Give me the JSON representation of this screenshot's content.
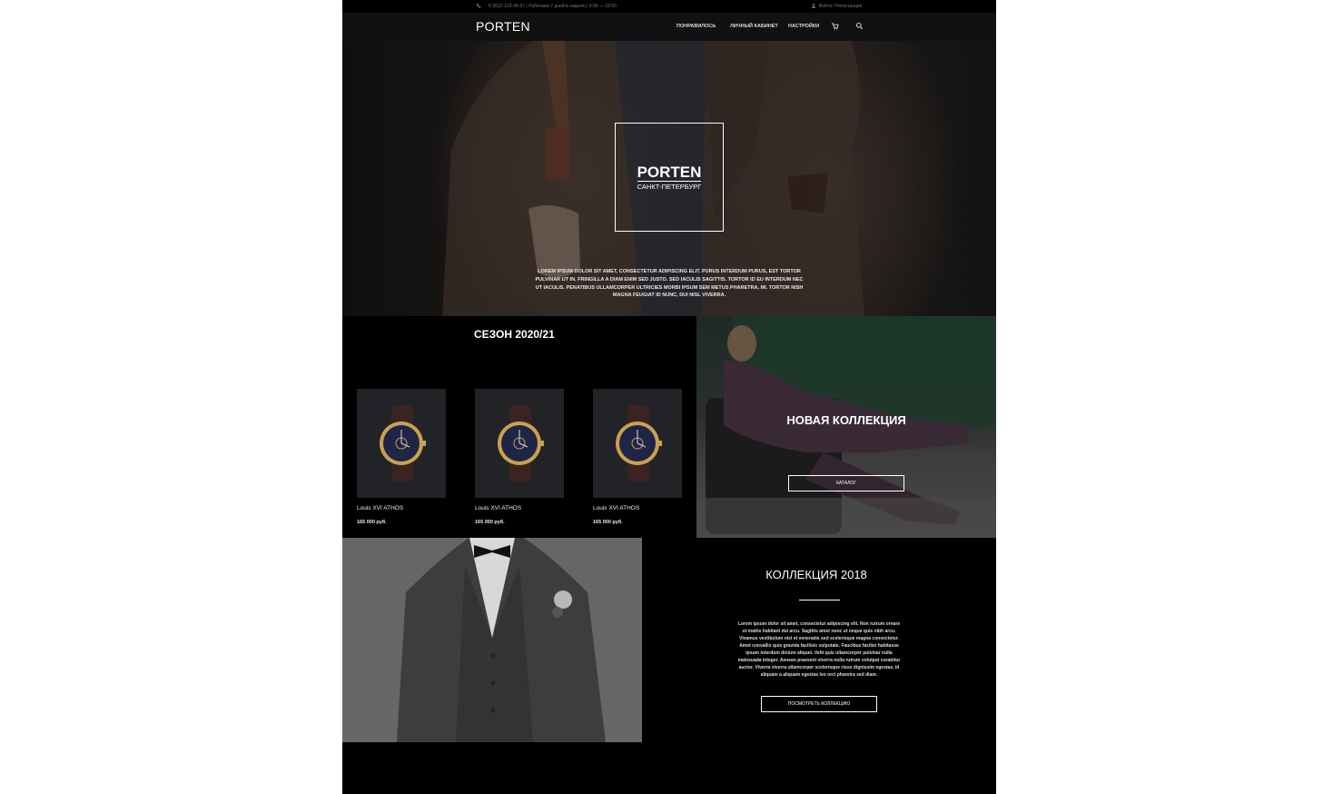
{
  "topbar": {
    "contact": "8 (812) 123-45-67 | Работаем 7 дней в неделю | 9:00 — 18:00",
    "login": "Войти / Регистрация"
  },
  "nav": {
    "logo": "PORTEN",
    "links": [
      "ПОНРАВИЛОСЬ",
      "ЛИЧНЫЙ КАБИНЕТ",
      "НАСТРОЙКИ"
    ],
    "icons": [
      "cart-icon",
      "search-icon"
    ]
  },
  "hero": {
    "brand": "PORTEN",
    "city": "САНКТ-ПЕТЕРБУРГ",
    "text": "LOREM IPSUM DOLOR SIT AMET, CONSECTETUR ADIPISCING ELIT. PURUS INTERDUM PURUS, EST TORTOR PULVINAR UT IN. FRINGILLA A DIAM ENIM SED JUSTO. SED IACULIS SAGITTIS. TORTOR ID EU INTERDUM NEC UT IACULIS. PENATIBUS ULLAMCORPER ULTRICIES MORBI IPSUM SEM METUS PHARETRA, MI. TORTOR NISH MAGNA FEUGIAT ID NUNC, DUI NISL VIVERRA."
  },
  "season": {
    "title": "СЕЗОН 2020/21",
    "products": [
      {
        "name": "Louis XVI ATHOS",
        "price": "165 000 руб."
      },
      {
        "name": "Louis XVI ATHOS",
        "price": "165 000 руб."
      },
      {
        "name": "Louis XVI ATHOS",
        "price": "165 000 руб."
      }
    ]
  },
  "new_collection": {
    "title": "НОВАЯ КОЛЛЕКЦИЯ",
    "button": "КАТАЛОГ"
  },
  "collection_2018": {
    "title": "КОЛЛЕКЦИЯ 2018",
    "text": "Lorem ipsum dolor sit amet, consectetur adipiscing elit. Non rutrum ornare ut mattis habitant dui arcu. Sagittis amet nunc ut neque quis nibh arcu. Vivamus vestibulum nisl et venenatis sed scelerisque magna consectetur. Amet convallis quis gravida facilisis vulputate. Faucibus facilisi habitasse ipsum interdum dictum aliquet. Velit quis ullamcorper pulvinar nulla malesuada integer. Aenean praesent viverra nulla rutrum volutpat curabitur auctor. Viverra viverra ullamcorper scelerisque risus dignissim egestas. Id aliquam a aliquam egestas leo orci pharetra sed diam.",
    "button": "ПОСМОТРЕТЬ КОЛЛЕКЦИЮ"
  },
  "colors": {
    "background": "#000000",
    "nav_bg": "#111111",
    "product_bg": "#222326",
    "text": "#ffffff"
  }
}
